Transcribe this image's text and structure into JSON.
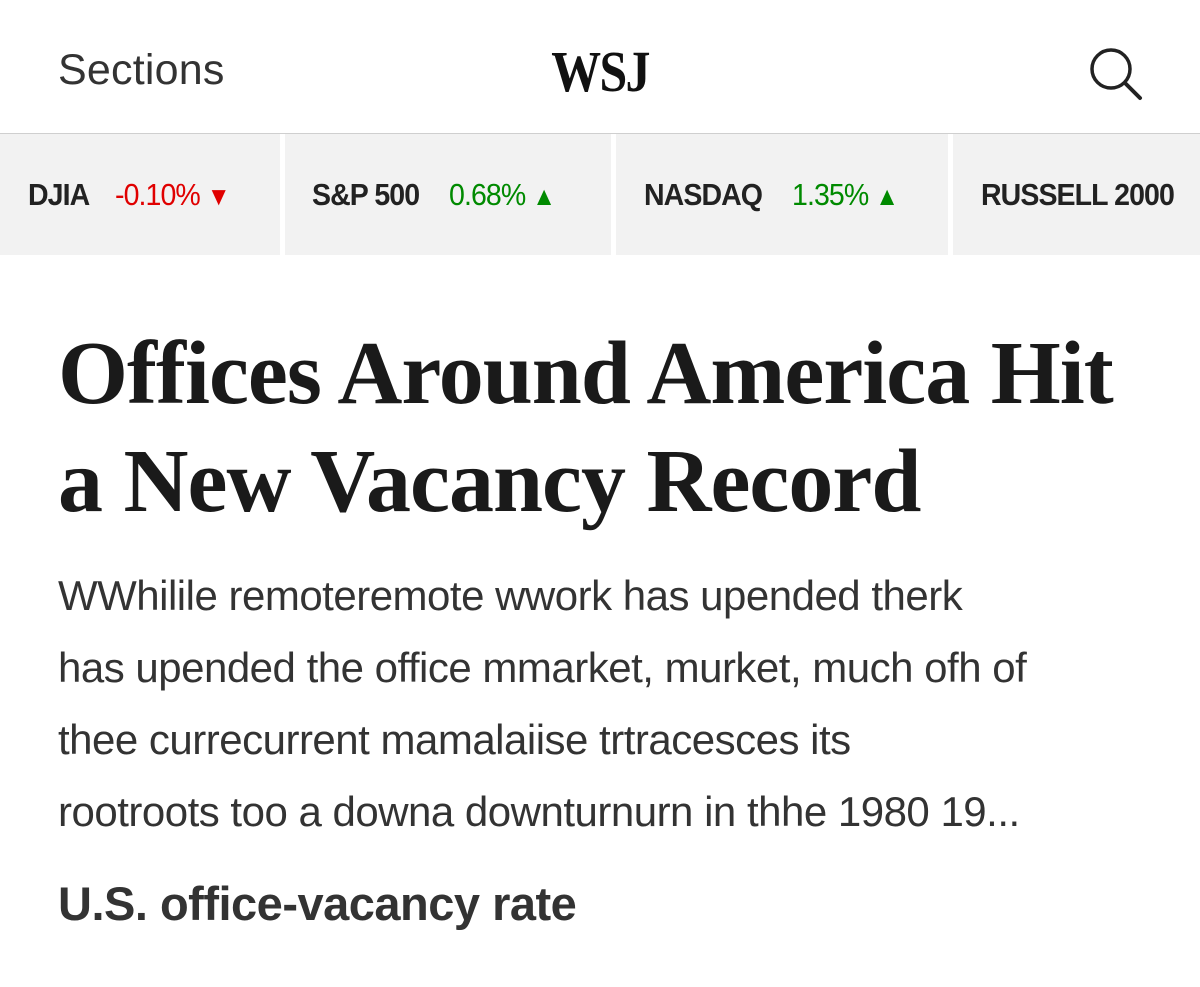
{
  "header": {
    "sections_label": "Sections",
    "logo_text": "WSJ",
    "search_icon": "search-icon"
  },
  "ticker": [
    {
      "name": "DJIA",
      "change": "-0.10%",
      "direction": "down",
      "arrow": "▼",
      "color": "#e00000"
    },
    {
      "name": "S&P 500",
      "change": "0.68%",
      "direction": "up",
      "arrow": "▲",
      "color": "#008a00"
    },
    {
      "name": "NASDAQ",
      "change": "1.35%",
      "direction": "up",
      "arrow": "▲",
      "color": "#008a00"
    },
    {
      "name": "RUSSELL 2000"
    }
  ],
  "article": {
    "headline_line1": "Offices Around America Hit",
    "headline_line2": "a New Vacancy Record",
    "dek_lines": [
      "WWhilile remoteremote wwork has upended therk",
      "has upended the office mmarket, murket, much ofh of",
      "thee currecurrent mamalaiise trtracesces its",
      "rootroots too a downa downturnurn in thhe 1980 19..."
    ],
    "chart_title": "U.S. office-vacancy rate"
  }
}
